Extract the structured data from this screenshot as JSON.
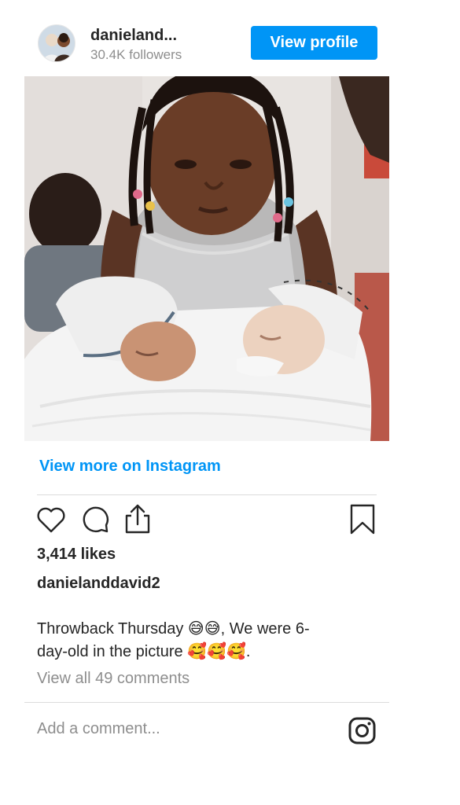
{
  "header": {
    "username": "danieland...",
    "followers": "30.4K followers",
    "view_profile_label": "View profile"
  },
  "post": {
    "image_alt": "Girl with braided hair looking down at two sleeping newborn twins wrapped in white",
    "view_more_label": "View more on Instagram",
    "likes": "3,414 likes",
    "caption_user": "danielanddavid2",
    "caption_line1": "Throwback Thursday 😅😅, We were 6-",
    "caption_line2": "day-old in the picture 🥰🥰🥰.",
    "comments_link": "View all 49 comments",
    "add_comment_placeholder": "Add a comment..."
  },
  "icons": {
    "like": "heart-icon",
    "comment": "comment-bubble-icon",
    "share": "share-icon",
    "save": "bookmark-icon",
    "instagram": "instagram-logo-icon"
  },
  "colors": {
    "accent": "#0095f6",
    "text": "#262626",
    "muted": "#8e8e8e",
    "divider": "#dbdbdb"
  }
}
